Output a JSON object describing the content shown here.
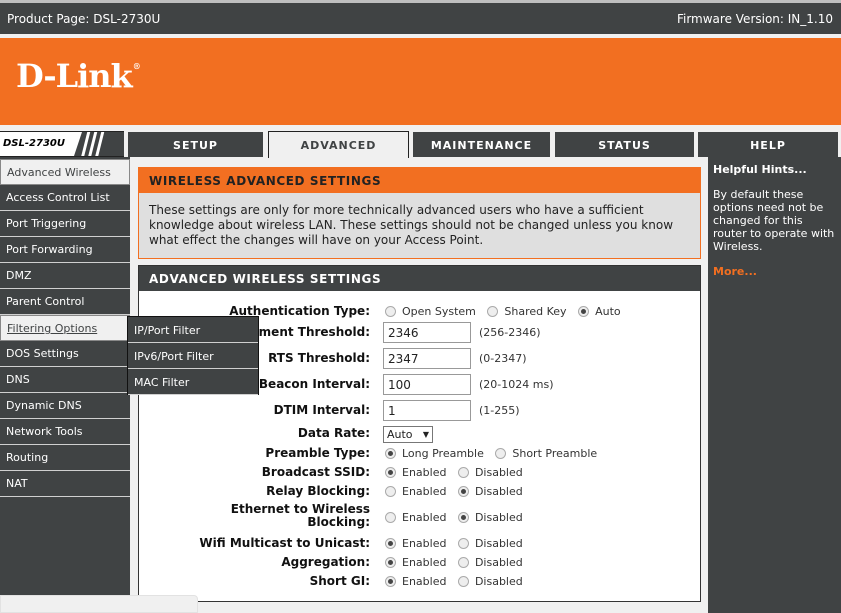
{
  "header": {
    "product_page": "Product Page: DSL-2730U",
    "firmware_version": "Firmware Version: IN_1.10"
  },
  "brand": {
    "logo_text": "D-Link",
    "registered": "®",
    "accent_color": "#f26f21",
    "dark_color": "#404344"
  },
  "model_label": "DSL-2730U",
  "tabs": [
    {
      "label": "SETUP",
      "active": false
    },
    {
      "label": "ADVANCED",
      "active": true
    },
    {
      "label": "MAINTENANCE",
      "active": false
    },
    {
      "label": "STATUS",
      "active": false
    },
    {
      "label": "HELP",
      "active": false
    }
  ],
  "sidebar": {
    "items": [
      {
        "label": "Advanced Wireless",
        "state": "active"
      },
      {
        "label": "Access Control List"
      },
      {
        "label": "Port Triggering"
      },
      {
        "label": "Port Forwarding"
      },
      {
        "label": "DMZ"
      },
      {
        "label": "Parent Control"
      },
      {
        "label": "Filtering Options",
        "state": "hover"
      },
      {
        "label": "DOS Settings"
      },
      {
        "label": "DNS"
      },
      {
        "label": "Dynamic DNS"
      },
      {
        "label": "Network Tools"
      },
      {
        "label": "Routing"
      },
      {
        "label": "NAT"
      }
    ],
    "flyout": [
      {
        "label": "IP/Port Filter"
      },
      {
        "label": "IPv6/Port Filter"
      },
      {
        "label": "MAC Filter"
      }
    ]
  },
  "intro": {
    "title": "WIRELESS ADVANCED SETTINGS",
    "text": "These settings are only for more technically advanced users who have a sufficient knowledge about wireless LAN. These settings should not be changed unless you know what effect the changes will have on your Access Point."
  },
  "settings": {
    "title": "ADVANCED WIRELESS SETTINGS",
    "auth_type": {
      "label": "Authentication Type:",
      "options": [
        "Open System",
        "Shared Key",
        "Auto"
      ],
      "selected": "Auto"
    },
    "fragment_threshold": {
      "label": "Fragment Threshold:",
      "value": "2346",
      "hint": "(256-2346)"
    },
    "rts_threshold": {
      "label": "RTS Threshold:",
      "value": "2347",
      "hint": "(0-2347)"
    },
    "beacon_interval": {
      "label": "Beacon Interval:",
      "value": "100",
      "hint": "(20-1024 ms)"
    },
    "dtim_interval": {
      "label": "DTIM Interval:",
      "value": "1",
      "hint": "(1-255)"
    },
    "data_rate": {
      "label": "Data Rate:",
      "value": "Auto"
    },
    "preamble_type": {
      "label": "Preamble Type:",
      "options": [
        "Long Preamble",
        "Short Preamble"
      ],
      "selected": "Long Preamble"
    },
    "broadcast_ssid": {
      "label": "Broadcast SSID:",
      "options": [
        "Enabled",
        "Disabled"
      ],
      "selected": "Enabled"
    },
    "relay_blocking": {
      "label": "Relay Blocking:",
      "options": [
        "Enabled",
        "Disabled"
      ],
      "selected": "Disabled"
    },
    "eth_wireless_blocking": {
      "label_line1": "Ethernet to Wireless",
      "label_line2": "Blocking:",
      "options": [
        "Enabled",
        "Disabled"
      ],
      "selected": "Disabled"
    },
    "wifi_multicast": {
      "label": "Wifi Multicast to Unicast:",
      "options": [
        "Enabled",
        "Disabled"
      ],
      "selected": "Enabled"
    },
    "aggregation": {
      "label": "Aggregation:",
      "options": [
        "Enabled",
        "Disabled"
      ],
      "selected": "Enabled"
    },
    "short_gi": {
      "label": "Short GI:",
      "options": [
        "Enabled",
        "Disabled"
      ],
      "selected": "Enabled"
    }
  },
  "hints": {
    "title": "Helpful Hints...",
    "body": "By default these options need not be changed for this router to operate with Wireless.",
    "more": "More..."
  }
}
